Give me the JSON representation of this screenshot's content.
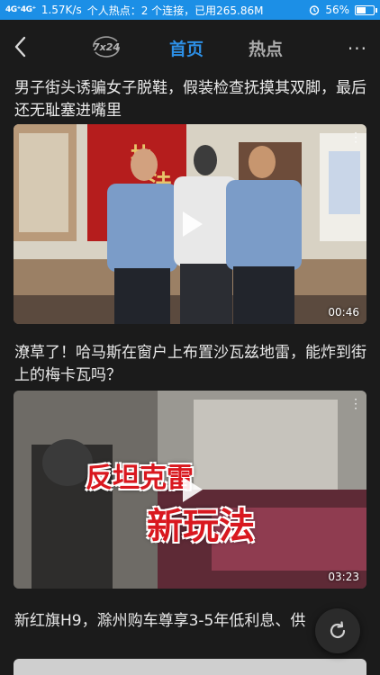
{
  "status_bar": {
    "signal": "4G⁺4G⁺",
    "speed": "1.57K/s",
    "hotspot": "个人热点：2 个连接，已用265.86M",
    "battery": "56%",
    "battery_level": 0.56
  },
  "nav": {
    "logo": "7x24",
    "tab_home": "首页",
    "tab_hot": "热点",
    "more": "···"
  },
  "feed": {
    "items": [
      {
        "title": "男子街头诱骗女子脱鞋，假装检查抚摸其双脚，最后还无耻塞进嘴里",
        "duration": "00:46",
        "sign_text": "执法公"
      },
      {
        "title": "潦草了！哈马斯在窗户上布置沙瓦兹地雷，能炸到街上的梅卡瓦吗？",
        "duration": "03:23",
        "overlay_line1": "反坦克雷",
        "overlay_line2": "新玩法"
      },
      {
        "title": "新红旗H9，滁州购车尊享3-5年低利息、供"
      }
    ]
  },
  "colors": {
    "accent": "#2d8fe5",
    "status_bar": "#1c8fe6",
    "background": "#1b1b1b"
  }
}
